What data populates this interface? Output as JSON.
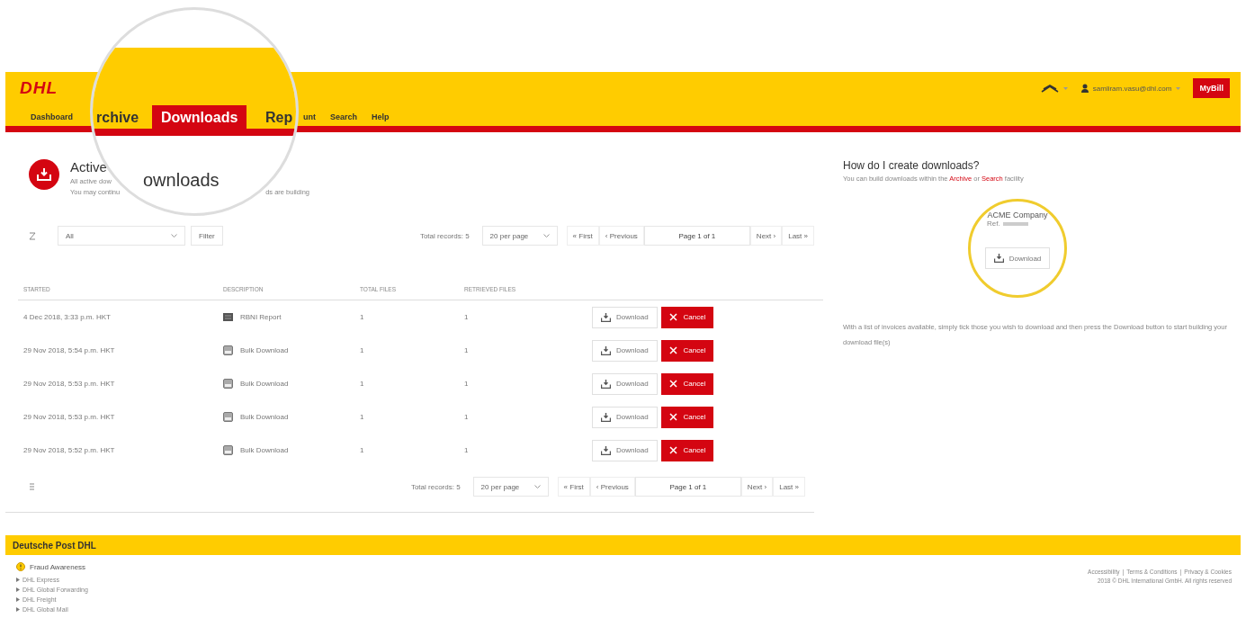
{
  "header": {
    "logo": "DHL",
    "user_email": "samliram.vasu@dhl.com",
    "mybill_button": "MyBill"
  },
  "nav": {
    "tabs": [
      {
        "label": "Dashboard",
        "selected": false
      },
      {
        "label": "unt",
        "selected": false
      },
      {
        "label": "Search",
        "selected": false
      },
      {
        "label": "Help",
        "selected": false
      }
    ]
  },
  "magnifier": {
    "tabs": [
      {
        "label": "rchive",
        "selected": false
      },
      {
        "label": "Downloads",
        "selected": true
      },
      {
        "label": "Rep",
        "selected": false
      }
    ],
    "heading": "ownloads"
  },
  "page_heading": {
    "title": "Active",
    "line_1": "All active dow",
    "line_2_start": "You may continu",
    "line_2_end": "ds are building"
  },
  "filter": {
    "value": "All",
    "button": "Filter"
  },
  "pagination_top": {
    "total": "Total records: 5",
    "per_page": "20 per page",
    "first": "« First",
    "previous": "‹ Previous",
    "page": "Page 1 of 1",
    "next": "Next ›",
    "last": "Last »"
  },
  "table": {
    "columns": [
      "STARTED",
      "DESCRIPTION",
      "TOTAL FILES",
      "RETRIEVED FILES"
    ],
    "rows": [
      {
        "started": "4 Dec 2018, 3:33 p.m. HKT",
        "kind": "report",
        "description": "RBNI Report",
        "total_files": "1",
        "retrieved_files": "1",
        "download": "Download",
        "cancel": "Cancel"
      },
      {
        "started": "29 Nov 2018, 5:54 p.m. HKT",
        "kind": "bulk",
        "description": "Bulk Download",
        "total_files": "1",
        "retrieved_files": "1",
        "download": "Download",
        "cancel": "Cancel"
      },
      {
        "started": "29 Nov 2018, 5:53 p.m. HKT",
        "kind": "bulk",
        "description": "Bulk Download",
        "total_files": "1",
        "retrieved_files": "1",
        "download": "Download",
        "cancel": "Cancel"
      },
      {
        "started": "29 Nov 2018, 5:53 p.m. HKT",
        "kind": "bulk",
        "description": "Bulk Download",
        "total_files": "1",
        "retrieved_files": "1",
        "download": "Download",
        "cancel": "Cancel"
      },
      {
        "started": "29 Nov 2018, 5:52 p.m. HKT",
        "kind": "bulk",
        "description": "Bulk Download",
        "total_files": "1",
        "retrieved_files": "1",
        "download": "Download",
        "cancel": "Cancel"
      }
    ]
  },
  "pagination_bottom": {
    "total": "Total records: 5",
    "per_page": "20 per page",
    "first": "« First",
    "previous": "‹ Previous",
    "page": "Page 1 of 1",
    "next": "Next ›",
    "last": "Last »"
  },
  "help": {
    "title": "How do I create downloads?",
    "intro_before": "You can build downloads within the ",
    "link_1": "Archive",
    "intro_middle": " or ",
    "link_2": "Search",
    "intro_after": " facility",
    "example_company": "ACME Company",
    "example_ref": "Ref.",
    "example_button": "Download",
    "paragraph": "With a list of invoices available, simply tick those you wish to download and then press the Download button to start building your download file(s)"
  },
  "footer": {
    "brand": "Deutsche Post DHL",
    "fraud": "Fraud Awareness",
    "links": [
      "DHL Express",
      "DHL Global Forwarding",
      "DHL Freight",
      "DHL Global Mail"
    ],
    "legal_links": [
      "Accessibility",
      "Terms & Conditions",
      "Privacy & Cookies"
    ],
    "separator": "|",
    "copyright": "2018 © DHL International GmbH. All rights reserved"
  }
}
